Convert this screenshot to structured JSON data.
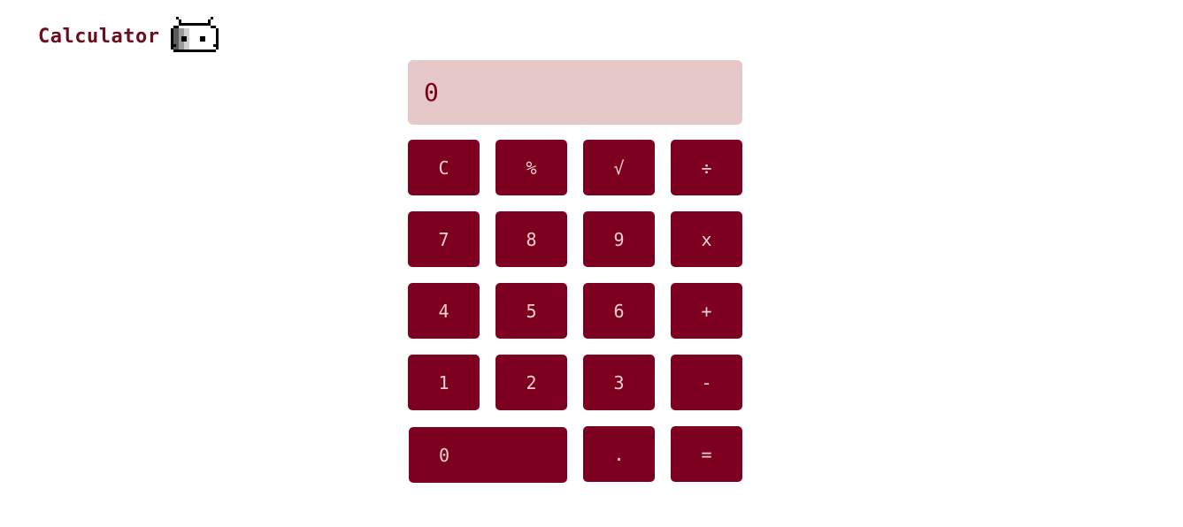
{
  "app": {
    "title": "Calculator",
    "icon": "robot-icon"
  },
  "display": {
    "value": "0"
  },
  "keys": {
    "clear": "C",
    "percent": "%",
    "sqrt": "√",
    "divide": "÷",
    "seven": "7",
    "eight": "8",
    "nine": "9",
    "multiply": "x",
    "four": "4",
    "five": "5",
    "six": "6",
    "add": "+",
    "one": "1",
    "two": "2",
    "three": "3",
    "subtract": "-",
    "zero": "0",
    "decimal": ".",
    "equals": "="
  },
  "colors": {
    "brand": "#6b0f1f",
    "key_bg": "#7d0020",
    "key_text": "#f1d2c8",
    "display_bg": "#e6c8c8",
    "display_text": "#7a0019"
  }
}
